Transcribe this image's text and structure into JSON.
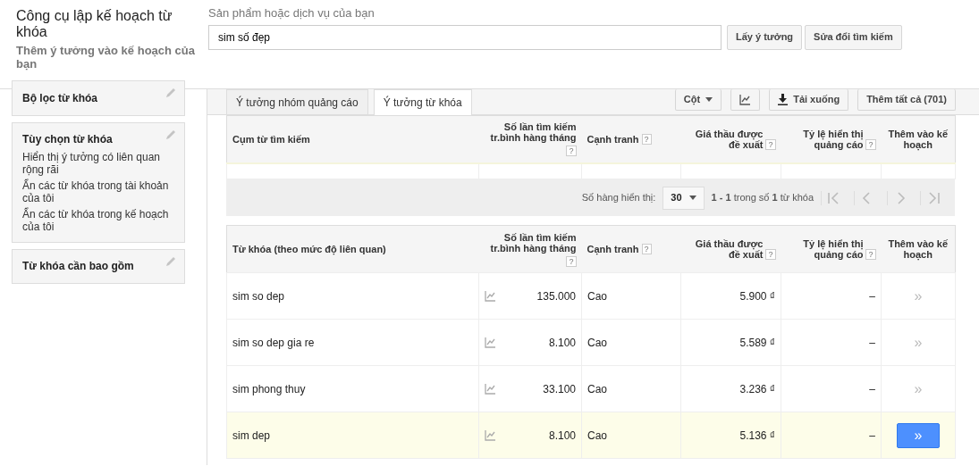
{
  "header": {
    "title": "Công cụ lập kế hoạch từ khóa",
    "subtitle": "Thêm ý tưởng vào kế hoạch của bạn",
    "search_label": "Sản phẩm hoặc dịch vụ của bạn",
    "search_value": "sim số đẹp",
    "buttons": [
      "Lấy ý tưởng",
      "Sửa đổi tìm kiếm"
    ]
  },
  "sidebar": [
    {
      "title": "Bộ lọc từ khóa"
    },
    {
      "title": "Tùy chọn từ khóa",
      "options": [
        "Hiển thị ý tưởng có liên quan rộng rãi",
        "Ẩn các từ khóa trong tài khoản của tôi",
        "Ẩn các từ khóa trong kế hoạch của tôi"
      ]
    },
    {
      "title": "Từ khóa cần bao gồm"
    }
  ],
  "tabs": [
    {
      "label": "Ý tưởng nhóm quảng cáo",
      "selected": false
    },
    {
      "label": "Ý tưởng từ khóa",
      "selected": true
    }
  ],
  "toolbar": {
    "columns_button": "Cột",
    "download_button": "Tải xuống",
    "add_all_button": "Thêm tất cả (701)"
  },
  "search_terms_table": {
    "columns": [
      {
        "label": "Cụm từ tìm kiếm"
      },
      {
        "label": "Số lần tìm kiếm tr.bình hàng tháng",
        "help": "?"
      },
      {
        "label": "Cạnh tranh",
        "help": "?"
      },
      {
        "label": "Giá thầu được đề xuất",
        "help": "?"
      },
      {
        "label": "Tỷ lệ hiển thị quảng cáo",
        "help": "?"
      },
      {
        "label": "Thêm vào kế hoạch"
      }
    ]
  },
  "pagination": {
    "rows_label": "Số hàng hiển thị:",
    "rows_value": "30",
    "range": "**1 - 1** trong số **1** từ khóa"
  },
  "keyword_table": {
    "columns": [
      {
        "label": "Từ khóa (theo mức độ liên quan)"
      },
      {
        "label": "Số lần tìm kiếm tr.bình hàng tháng",
        "help": "?"
      },
      {
        "label": "Cạnh tranh",
        "help": "?"
      },
      {
        "label": "Giá thầu được đề xuất",
        "help": "?"
      },
      {
        "label": "Tỷ lệ hiển thị quảng cáo",
        "help": "?"
      },
      {
        "label": "Thêm vào kế hoạch"
      }
    ],
    "rows": [
      {
        "keyword": "sim so dep",
        "volume": "135.000",
        "competition": "Cao",
        "bid": "5.900 ₫",
        "impression_share": "–",
        "add": "»",
        "highlighted": false
      },
      {
        "keyword": "sim so dep gia re",
        "volume": "8.100",
        "competition": "Cao",
        "bid": "5.589 ₫",
        "impression_share": "–",
        "add": "»",
        "highlighted": false
      },
      {
        "keyword": "sim phong thuy",
        "volume": "33.100",
        "competition": "Cao",
        "bid": "3.236 ₫",
        "impression_share": "–",
        "add": "»",
        "highlighted": false
      },
      {
        "keyword": "sim dep",
        "volume": "8.100",
        "competition": "Cao",
        "bid": "5.136 ₫",
        "impression_share": "–",
        "add": "»",
        "highlighted": true
      }
    ]
  }
}
